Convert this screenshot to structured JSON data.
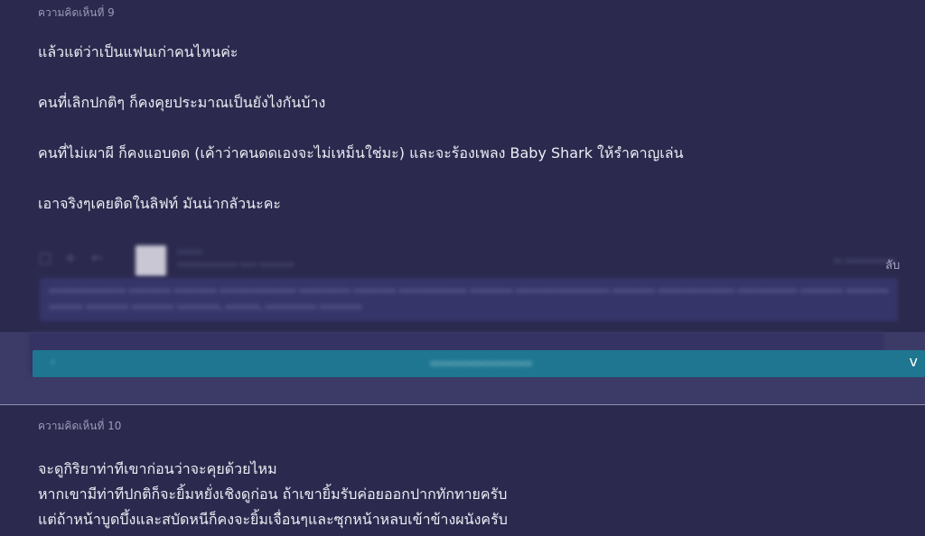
{
  "comment9": {
    "label": "ความคิดเห็นที่ 9",
    "paragraphs": [
      "แล้วแต่ว่าเป็นแฟนเก่าคนไหนค่ะ",
      "คนที่เลิกปกติๆ ก็คงคุยประมาณเป็นยังไงกันบ้าง",
      "คนที่ไม่เผาผี ก็คงแอบดด (เค้าว่าคนดดเองจะไม่เหม็นใช่มะ) และจะร้องเพลง Baby Shark ให้รำคาญเล่น",
      "เอาจริงๆเคยติดในลิฟท์ มันน่ากลัวนะคะ"
    ],
    "reply_suffix": "ลับ",
    "expand_chevron": "v"
  },
  "comment10": {
    "label": "ความคิดเห็นที่ 10",
    "lines": [
      "จะดูกิริยาท่าทีเขาก่อนว่าจะคุยด้วยไหม",
      "หากเขามีท่าทีปกติก็จะยิ้มหยั่งเชิงดูก่อน ถ้าเขายิ้มรับค่อยออกปากทักทายครับ",
      "แต่ถ้าหน้าบูดบึ้งและสบัดหนีก็คงจะยิ้มเจื่อนๆและซุกหน้าหลบเข้าข้างผนังครับ"
    ]
  }
}
